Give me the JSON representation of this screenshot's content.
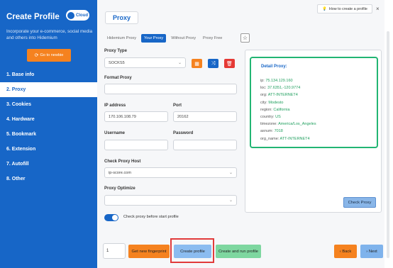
{
  "sidebar": {
    "title": "Create Profile",
    "cloud_label": "Cloud",
    "description": "Incorporate your e-commerce, social media and others into Hidemium",
    "goto_button": "Go to newbie",
    "items": [
      {
        "label": "1. Base info"
      },
      {
        "label": "2. Proxy"
      },
      {
        "label": "3. Cookies"
      },
      {
        "label": "4. Hardware"
      },
      {
        "label": "5. Bookmark"
      },
      {
        "label": "6. Extension"
      },
      {
        "label": "7. Autofill"
      },
      {
        "label": "8. Other"
      }
    ]
  },
  "header": {
    "title": "Proxy",
    "howto": "How to create a profile",
    "close": "×"
  },
  "tabs": [
    "Hidemium Proxy",
    "Your Proxy",
    "Without Proxy",
    "Proxy Free"
  ],
  "form": {
    "proxy_type_label": "Proxy Type",
    "proxy_type_value": "SOCKS5",
    "format_proxy_label": "Format Proxy",
    "ip_label": "IP address",
    "ip_value": "170.106.108.79",
    "port_label": "Port",
    "port_value": "20162",
    "username_label": "Username",
    "password_label": "Password",
    "check_host_label": "Check Proxy Host",
    "check_host_value": "ip-score.com",
    "optimize_label": "Proxy Optimize",
    "toggle_label": "Check proxy before start profile"
  },
  "detail": {
    "title": "Detail Proxy:",
    "lines": [
      {
        "k": "ip:",
        "v": "75.134.129.160"
      },
      {
        "k": "loc:",
        "v": "37.6351,-120.9774"
      },
      {
        "k": "org:",
        "v": "ATT-INTERNET4"
      },
      {
        "k": "city:",
        "v": "Modesto"
      },
      {
        "k": "region:",
        "v": "California"
      },
      {
        "k": "country:",
        "v": "US"
      },
      {
        "k": "timezone:",
        "v": "America/Los_Angeles"
      },
      {
        "k": "asnum:",
        "v": "7018"
      },
      {
        "k": "org_name:",
        "v": "ATT-INTERNET4"
      }
    ],
    "check_button": "Check Proxy"
  },
  "footer": {
    "quantity": "1",
    "fingerprint_button": "Get new fingerprint",
    "create_button": "Create profile",
    "create_run_button": "Create and run profile",
    "back_button": "Back",
    "next_button": "Next"
  },
  "colors": {
    "primary": "#1766c7",
    "accent_orange": "#f5821f",
    "success_green": "#22b573",
    "danger_red": "#e53935",
    "highlight_red": "#e13b3b"
  }
}
